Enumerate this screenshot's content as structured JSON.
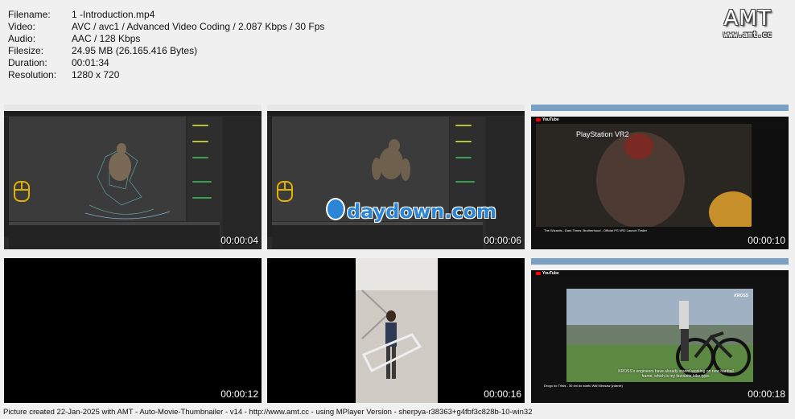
{
  "info": [
    {
      "key": "Filename:",
      "value": "1 -Introduction.mp4"
    },
    {
      "key": "Video:",
      "value": "AVC / avc1 / Advanced Video Coding / 2.087 Kbps / 30 Fps"
    },
    {
      "key": "Audio:",
      "value": "AAC / 128 Kbps"
    },
    {
      "key": "Filesize:",
      "value": "24.95 MB (26.165.416 Bytes)"
    },
    {
      "key": "Duration:",
      "value": "00:01:34"
    },
    {
      "key": "Resolution:",
      "value": "1280 x 720"
    }
  ],
  "logo": {
    "title": "AMT",
    "url": "www.amt.cc"
  },
  "thumbnails": [
    {
      "timestamp": "00:00:04"
    },
    {
      "timestamp": "00:00:06",
      "watermark": "daydown.com"
    },
    {
      "timestamp": "00:00:10",
      "logo_text": "PlayStation VR2",
      "video_title": "The Wizards - Dark Times: Brotherhood - Official PS VR2 Launch Trailer",
      "site": "YouTube"
    },
    {
      "timestamp": "00:00:12"
    },
    {
      "timestamp": "00:00:16"
    },
    {
      "timestamp": "00:00:18",
      "site": "YouTube",
      "brand": "KROSS",
      "caption": "KROSS's engineers have already stared working on new hardtail frame, which is my favourite bike type.",
      "video_title": "Drogo do Trfais - 30 dni do startu Wal Mirosaw (zdanie)"
    }
  ],
  "footer": "Picture created 22-Jan-2025 with AMT - Auto-Movie-Thumbnailer - v14 - http://www.amt.cc - using MPlayer Version - sherpya-r38363+g4fbf3c828b-10-win32"
}
